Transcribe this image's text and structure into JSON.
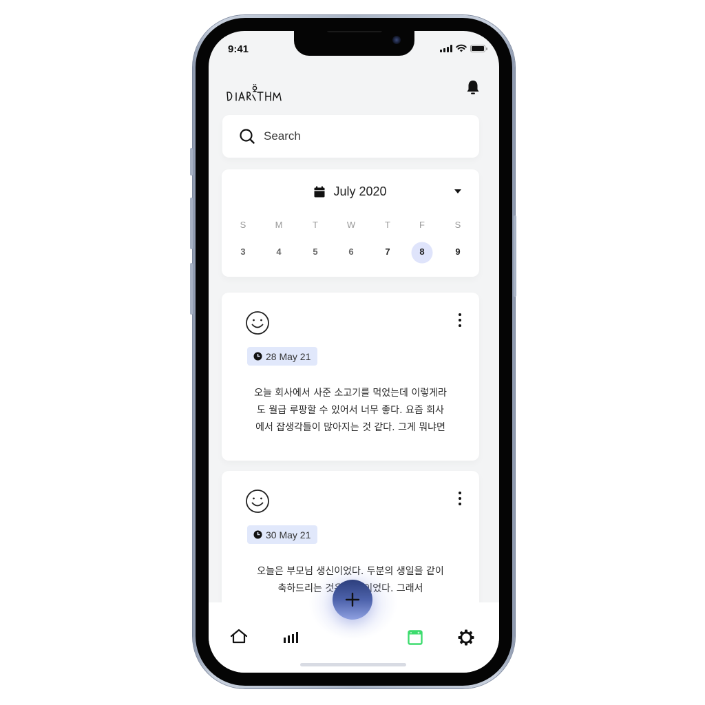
{
  "status_bar": {
    "time": "9:41",
    "icons": [
      "cellular-signal-icon",
      "wifi-icon",
      "battery-icon"
    ]
  },
  "header": {
    "logo_text": "DIARITHM",
    "notification_icon": "bell-icon"
  },
  "search": {
    "icon": "search-icon",
    "placeholder": "Search"
  },
  "calendar": {
    "icon": "calendar-icon",
    "month_label": "July 2020",
    "dropdown_icon": "caret-down-icon",
    "weekdays": [
      "S",
      "M",
      "T",
      "W",
      "T",
      "F",
      "S"
    ],
    "dates": [
      "3",
      "4",
      "5",
      "6",
      "7",
      "8",
      "9"
    ],
    "selected_date": "8",
    "selected_color": "#dfe4fb"
  },
  "entries": [
    {
      "mood_icon": "smiley-face-icon",
      "menu_icon": "more-vertical-icon",
      "date_icon": "clock-icon",
      "date": "28 May 21",
      "body_lines": [
        "오늘 회사에서 사준 소고기를 먹었는데 이렇게라",
        "도 월급 루팡할 수 있어서 너무 좋다. 요즘 회사",
        "에서 잡생각들이 많아지는 것 같다. 그게 뭐냐면"
      ]
    },
    {
      "mood_icon": "smiley-face-icon",
      "menu_icon": "more-vertical-icon",
      "date_icon": "clock-icon",
      "date": "30 May 21",
      "body_lines": [
        "오늘은 부모님 생신이었다. 두분의 생일을 같이",
        "축하드리는 것은 처음이었다. 그래서"
      ]
    }
  ],
  "fab": {
    "icon": "plus-icon",
    "gradient": [
      "#2d3f7d",
      "#8ea0e0"
    ]
  },
  "tab_bar": {
    "items": [
      {
        "name": "home",
        "icon": "home-icon",
        "active": false
      },
      {
        "name": "stats",
        "icon": "bar-chart-icon",
        "active": false
      },
      {
        "name": "diary",
        "icon": "calendar-window-icon",
        "active": true
      },
      {
        "name": "settings",
        "icon": "gear-icon",
        "active": false
      }
    ],
    "active_color": "#3ddc6e"
  },
  "colors": {
    "screen_bg": "#f3f4f5",
    "card_bg": "#ffffff",
    "date_chip_bg": "#e1e8fb"
  }
}
